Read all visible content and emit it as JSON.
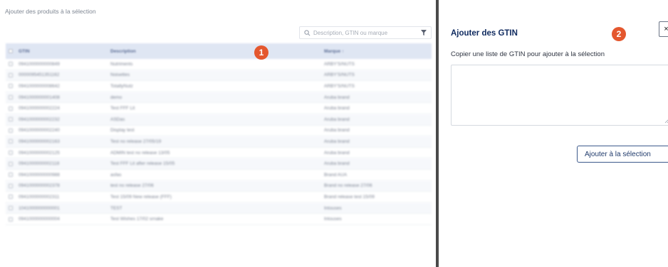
{
  "left_panel": {
    "title": "Ajouter des produits à la sélection",
    "search": {
      "placeholder": "Description, GTIN ou marque"
    },
    "table": {
      "columns": [
        "GTIN",
        "Description",
        "Marque ↑"
      ],
      "rows": [
        {
          "gtin": "0941000000000849",
          "description": "Nutriments",
          "brand": "ARBY'S/NUTS"
        },
        {
          "gtin": "0000095451351162",
          "description": "Noisettes",
          "brand": "ARBY'S/NUTS"
        },
        {
          "gtin": "0941000000008642",
          "description": "TotallyNutz",
          "brand": "ARBY'S/NUTS"
        },
        {
          "gtin": "0941000000001408",
          "description": "demo",
          "brand": "Aruba brand"
        },
        {
          "gtin": "0941000000002224",
          "description": "Test FFF Lit",
          "brand": "Aruba brand"
        },
        {
          "gtin": "0941000000002232",
          "description": "ASDas",
          "brand": "Aruba brand"
        },
        {
          "gtin": "0941000000002240",
          "description": "Display test",
          "brand": "Aruba brand"
        },
        {
          "gtin": "0941000000002163",
          "description": "Test no release 27/05/19",
          "brand": "Aruba brand"
        },
        {
          "gtin": "0941000000002125",
          "description": "ADMIN test no release 13/05",
          "brand": "Aruba brand"
        },
        {
          "gtin": "0941000000002118",
          "description": "Test FFF Lit after release 15/05",
          "brand": "Aruba brand"
        },
        {
          "gtin": "0941000000000988",
          "description": "asfas",
          "brand": "Brand AUA"
        },
        {
          "gtin": "0941000000002378",
          "description": "test no release 27/06",
          "brand": "Brand no release 27/06"
        },
        {
          "gtin": "0941000000002311",
          "description": "Test 15/09 New release (FFF)",
          "brand": "Brand release test 15/09"
        },
        {
          "gtin": "1041000000000001",
          "description": "TEST",
          "brand": "Intouses"
        },
        {
          "gtin": "0941000000000004",
          "description": "Test Wishes 17/02 srnake",
          "brand": "Intouses"
        }
      ]
    }
  },
  "badges": {
    "one": "1",
    "two": "2"
  },
  "right_panel": {
    "title": "Ajouter des GTIN",
    "close_label": "×",
    "subtitle": "Copier une liste de GTIN pour ajouter à la sélection",
    "textarea_value": "",
    "add_button_label": "Ajouter à la sélection"
  },
  "colors": {
    "accent_badge": "#e4572e",
    "title_navy": "#0f2a5f",
    "table_header_bg": "#dfe6f3",
    "divider": "#4a4a4a"
  },
  "icons": {
    "search": "search-icon",
    "filter": "filter-icon",
    "close": "close-icon"
  }
}
